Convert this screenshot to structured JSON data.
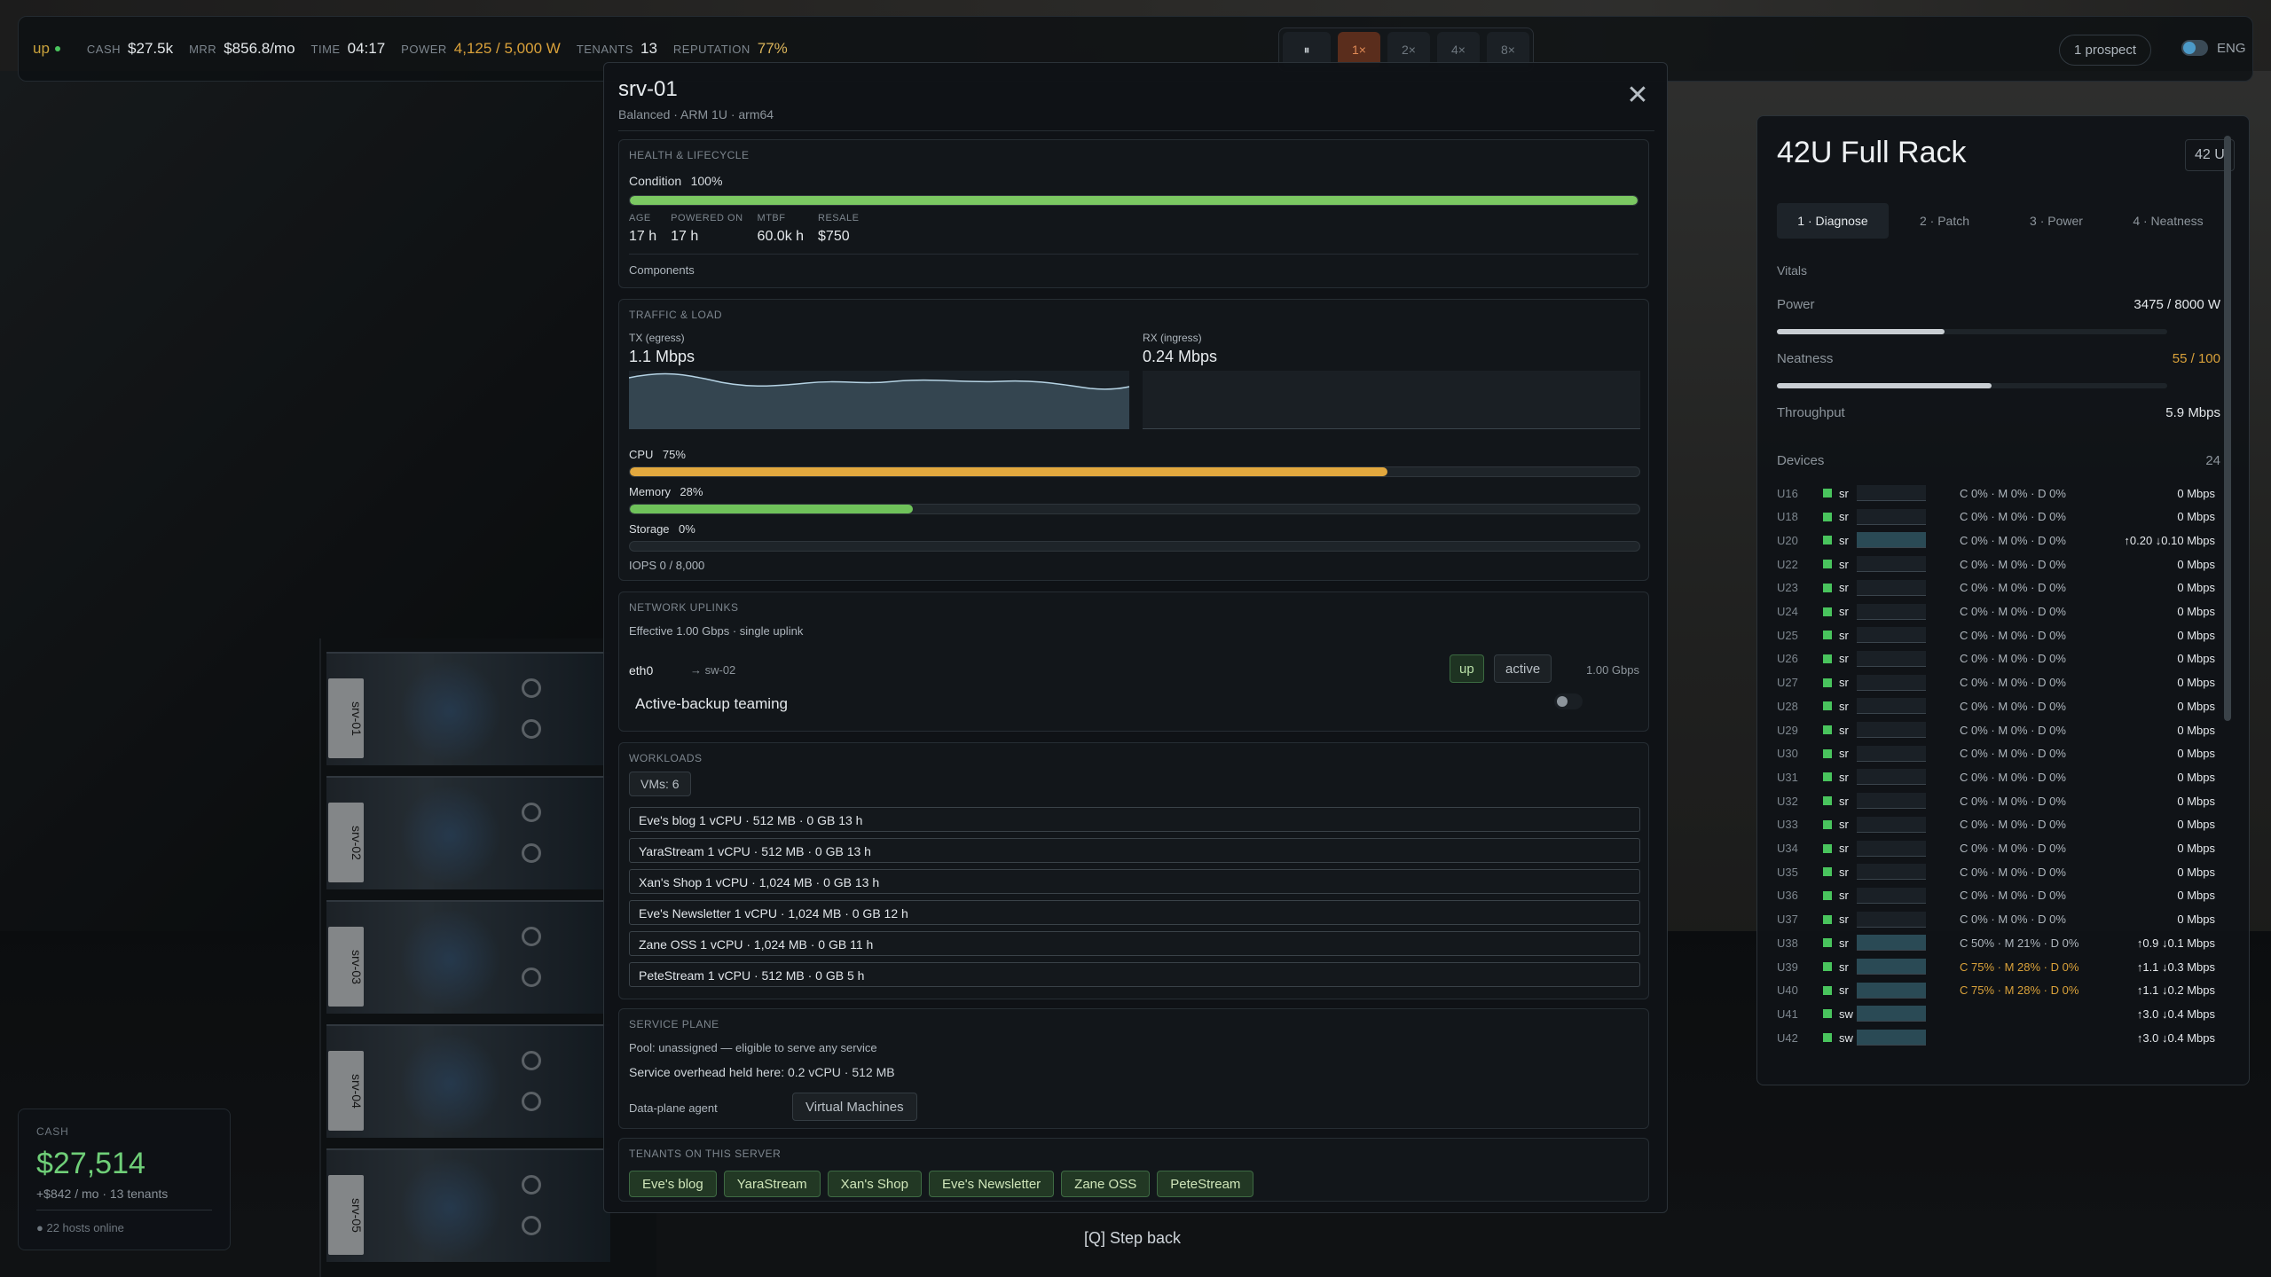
{
  "hud": {
    "status": "up",
    "cash_k": "CASH",
    "cash_v": "$27.5k",
    "mrr_k": "MRR",
    "mrr_v": "$856.8/mo",
    "time_k": "TIME",
    "time_v": "04:17",
    "power_k": "POWER",
    "power_v": "4,125 / 5,000 W",
    "tenants_k": "TENANTS",
    "tenants_v": "13",
    "rep_k": "REPUTATION",
    "rep_v": "77%",
    "speed": [
      "1×",
      "2×",
      "4×",
      "8×"
    ],
    "pause": "⏸",
    "prospect": "1 prospect",
    "lang": "ENG"
  },
  "cash_card": {
    "label": "CASH",
    "value": "$27,514",
    "sub": "+$842 / mo · 13 tenants",
    "hosts": "● 22 hosts online"
  },
  "scene": {
    "server_labels": [
      "srv-01",
      "srv-02",
      "srv-03",
      "srv-04",
      "srv-05"
    ]
  },
  "modal": {
    "title": "srv-01",
    "subtitle": "Balanced · ARM 1U · arm64",
    "close": "✕",
    "health": {
      "title": "HEALTH & LIFECYCLE",
      "condition_label": "Condition",
      "condition_value": "100%",
      "condition_pct": 100,
      "age_k": "AGE",
      "age_v": "17 h",
      "powered_k": "POWERED ON",
      "powered_v": "17 h",
      "mtbf_k": "MTBF",
      "mtbf_v": "60.0k h",
      "resale_k": "RESALE",
      "resale_v": "$750",
      "components": "Components"
    },
    "traffic": {
      "title": "TRAFFIC & LOAD",
      "tx_label": "TX (egress)",
      "tx_value": "1.1 Mbps",
      "rx_label": "RX (ingress)",
      "rx_value": "0.24 Mbps",
      "cpu_label": "CPU",
      "cpu_value": "75%",
      "cpu_pct": 75,
      "mem_label": "Memory",
      "mem_value": "28%",
      "mem_pct": 28,
      "sto_label": "Storage",
      "sto_value": "0%",
      "sto_pct": 0,
      "iops": "IOPS  0 / 8,000"
    },
    "network": {
      "title": "NETWORK UPLINKS",
      "effective": "Effective 1.00 Gbps  ·  single uplink",
      "iface": "eth0",
      "peer": "→ sw-02",
      "state_up": "up",
      "state_active": "active",
      "speed": "1.00 Gbps",
      "teaming": "Active-backup teaming"
    },
    "workloads": {
      "title": "WORKLOADS",
      "vms": "VMs: 6",
      "rows": [
        "Eve's blog   1 vCPU · 512 MB · 0 GB   13 h",
        "YaraStream   1 vCPU · 512 MB · 0 GB   13 h",
        "Xan's Shop   1 vCPU · 1,024 MB · 0 GB   13 h",
        "Eve's Newsletter   1 vCPU · 1,024 MB · 0 GB   12 h",
        "Zane OSS   1 vCPU · 1,024 MB · 0 GB   11 h",
        "PeteStream   1 vCPU · 512 MB · 0 GB   5 h"
      ]
    },
    "service": {
      "title": "SERVICE PLANE",
      "pool": "Pool: unassigned — eligible to serve any service",
      "overhead": "Service overhead held here: 0.2 vCPU · 512 MB",
      "agent_label": "Data-plane agent",
      "agent_value": "Virtual Machines"
    },
    "tenants": {
      "title": "TENANTS ON THIS SERVER",
      "items": [
        "Eve's blog",
        "YaraStream",
        "Xan's Shop",
        "Eve's Newsletter",
        "Zane OSS",
        "PeteStream"
      ]
    },
    "step_back": "[Q]  Step back"
  },
  "rack": {
    "title": "42U Full Rack",
    "u_badge": "42 U",
    "tabs": [
      "1 · Diagnose",
      "2 · Patch",
      "3 · Power",
      "4 · Neatness"
    ],
    "vitals": "Vitals",
    "power_k": "Power",
    "power_v": "3475 / 8000 W",
    "power_pct": 43,
    "neat_k": "Neatness",
    "neat_v": "55 / 100",
    "neat_pct": 55,
    "thr_k": "Throughput",
    "thr_v": "5.9 Mbps",
    "devices_k": "Devices",
    "devices_v": "24",
    "devices": [
      {
        "slot": "U16",
        "nm": "sr",
        "usage": "C 0% · M 0% · D 0%",
        "net": "0 Mbps",
        "lit": false,
        "warn": false
      },
      {
        "slot": "U18",
        "nm": "sr",
        "usage": "C 0% · M 0% · D 0%",
        "net": "0 Mbps",
        "lit": false,
        "warn": false
      },
      {
        "slot": "U20",
        "nm": "sr",
        "usage": "C 0% · M 0% · D 0%",
        "net": "↑0.20 ↓0.10 Mbps",
        "lit": true,
        "warn": false
      },
      {
        "slot": "U22",
        "nm": "sr",
        "usage": "C 0% · M 0% · D 0%",
        "net": "0 Mbps",
        "lit": false,
        "warn": false
      },
      {
        "slot": "U23",
        "nm": "sr",
        "usage": "C 0% · M 0% · D 0%",
        "net": "0 Mbps",
        "lit": false,
        "warn": false
      },
      {
        "slot": "U24",
        "nm": "sr",
        "usage": "C 0% · M 0% · D 0%",
        "net": "0 Mbps",
        "lit": false,
        "warn": false
      },
      {
        "slot": "U25",
        "nm": "sr",
        "usage": "C 0% · M 0% · D 0%",
        "net": "0 Mbps",
        "lit": false,
        "warn": false
      },
      {
        "slot": "U26",
        "nm": "sr",
        "usage": "C 0% · M 0% · D 0%",
        "net": "0 Mbps",
        "lit": false,
        "warn": false
      },
      {
        "slot": "U27",
        "nm": "sr",
        "usage": "C 0% · M 0% · D 0%",
        "net": "0 Mbps",
        "lit": false,
        "warn": false
      },
      {
        "slot": "U28",
        "nm": "sr",
        "usage": "C 0% · M 0% · D 0%",
        "net": "0 Mbps",
        "lit": false,
        "warn": false
      },
      {
        "slot": "U29",
        "nm": "sr",
        "usage": "C 0% · M 0% · D 0%",
        "net": "0 Mbps",
        "lit": false,
        "warn": false
      },
      {
        "slot": "U30",
        "nm": "sr",
        "usage": "C 0% · M 0% · D 0%",
        "net": "0 Mbps",
        "lit": false,
        "warn": false
      },
      {
        "slot": "U31",
        "nm": "sr",
        "usage": "C 0% · M 0% · D 0%",
        "net": "0 Mbps",
        "lit": false,
        "warn": false
      },
      {
        "slot": "U32",
        "nm": "sr",
        "usage": "C 0% · M 0% · D 0%",
        "net": "0 Mbps",
        "lit": false,
        "warn": false
      },
      {
        "slot": "U33",
        "nm": "sr",
        "usage": "C 0% · M 0% · D 0%",
        "net": "0 Mbps",
        "lit": false,
        "warn": false
      },
      {
        "slot": "U34",
        "nm": "sr",
        "usage": "C 0% · M 0% · D 0%",
        "net": "0 Mbps",
        "lit": false,
        "warn": false
      },
      {
        "slot": "U35",
        "nm": "sr",
        "usage": "C 0% · M 0% · D 0%",
        "net": "0 Mbps",
        "lit": false,
        "warn": false
      },
      {
        "slot": "U36",
        "nm": "sr",
        "usage": "C 0% · M 0% · D 0%",
        "net": "0 Mbps",
        "lit": false,
        "warn": false
      },
      {
        "slot": "U37",
        "nm": "sr",
        "usage": "C 0% · M 0% · D 0%",
        "net": "0 Mbps",
        "lit": false,
        "warn": false
      },
      {
        "slot": "U38",
        "nm": "sr",
        "usage": "C 50% · M 21% · D 0%",
        "net": "↑0.9 ↓0.1 Mbps",
        "lit": true,
        "warn": false
      },
      {
        "slot": "U39",
        "nm": "sr",
        "usage": "C 75% · M 28% · D 0%",
        "net": "↑1.1 ↓0.3 Mbps",
        "lit": true,
        "warn": true
      },
      {
        "slot": "U40",
        "nm": "sr",
        "usage": "C 75% · M 28% · D 0%",
        "net": "↑1.1 ↓0.2 Mbps",
        "lit": true,
        "warn": true
      },
      {
        "slot": "U41",
        "nm": "sw",
        "usage": "",
        "net": "↑3.0 ↓0.4 Mbps",
        "lit": true,
        "warn": false
      },
      {
        "slot": "U42",
        "nm": "sw",
        "usage": "",
        "net": "↑3.0 ↓0.4 Mbps",
        "lit": true,
        "warn": false
      }
    ]
  }
}
